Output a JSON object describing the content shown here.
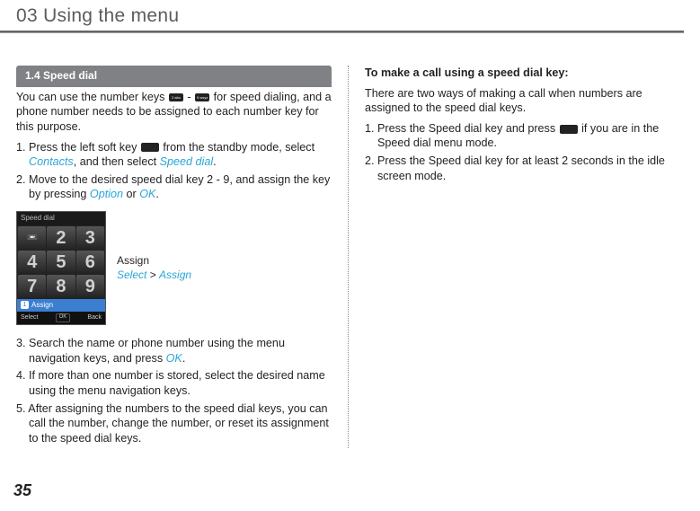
{
  "header": "03 Using the menu",
  "section_tab": "1.4  Speed dial",
  "left": {
    "intro_a": "You can use the number keys ",
    "intro_b": " - ",
    "intro_c": " for speed dialing, and a phone number needs to be assigned to each number key for this purpose.",
    "key2": "2 abc",
    "key9": "9 wxyz",
    "step1_a": "1. Press the left soft key ",
    "step1_b": " from the standby mode, select ",
    "step1_contacts": "Contacts",
    "step1_c": ", and then select ",
    "step1_speed": "Speed dial",
    "step1_d": ".",
    "step2_a": "2. Move to the desired speed dial key 2 - 9, and assign the key by pressing ",
    "step2_option": "Option",
    "step2_b": " or ",
    "step2_ok": "OK",
    "step2_c": ".",
    "assign_label": "Assign",
    "assign_select": "Select",
    "assign_gt": " > ",
    "assign_assign": "Assign",
    "step3_a": "3. Search the name or phone number using the menu navigation keys, and press ",
    "step3_ok": "OK",
    "step3_b": ".",
    "step4": "4. If more than one number is stored, select the desired name using the menu navigation keys.",
    "step5": "5. After assigning the numbers to the speed dial keys, you can call the number, change the number, or reset its assignment to the speed dial keys."
  },
  "screen": {
    "title": "Speed dial",
    "cells": [
      "📼",
      "2",
      "3",
      "4",
      "5",
      "6",
      "7",
      "8",
      "9"
    ],
    "assign_num": "1",
    "assign_text": "Assign",
    "soft_left": "Select",
    "soft_mid": "OK",
    "soft_right": "Back"
  },
  "right": {
    "heading": "To make a call using a speed dial key:",
    "intro": "There are two ways of making a call when numbers are assigned to the speed dial keys.",
    "step1_a": "1. Press the Speed dial key and press ",
    "step1_b": " if you are in the Speed dial menu mode.",
    "step2": "2. Press the Speed dial key for at least 2 seconds in the idle screen mode."
  },
  "page_num": "35"
}
